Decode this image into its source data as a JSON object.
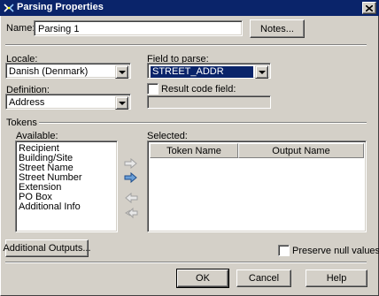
{
  "window": {
    "title": "Parsing Properties"
  },
  "name": {
    "label": "Name:",
    "value": "Parsing 1",
    "notes_button": "Notes..."
  },
  "locale": {
    "label": "Locale:",
    "value": "Danish (Denmark)"
  },
  "field_to_parse": {
    "label": "Field to parse:",
    "value": "STREET_ADDR"
  },
  "definition": {
    "label": "Definition:",
    "value": "Address"
  },
  "result_code": {
    "label": "Result code field:",
    "checked": false,
    "value": ""
  },
  "tokens": {
    "label": "Tokens",
    "available_label": "Available:",
    "available_items": [
      "Recipient",
      "Building/Site",
      "Street Name",
      "Street Number",
      "Extension",
      "PO Box",
      "Additional Info"
    ],
    "selected_label": "Selected:",
    "columns": [
      "Token Name",
      "Output Name"
    ]
  },
  "additional_outputs_button": "Additional Outputs...",
  "preserve_null": {
    "label": "Preserve null values",
    "checked": false
  },
  "buttons": {
    "ok": "OK",
    "cancel": "Cancel",
    "help": "Help"
  },
  "colors": {
    "title_bar": "#0a246a",
    "face": "#d4d0c8",
    "selection": "#0a246a",
    "arrow_active": "#3a6ea5"
  }
}
